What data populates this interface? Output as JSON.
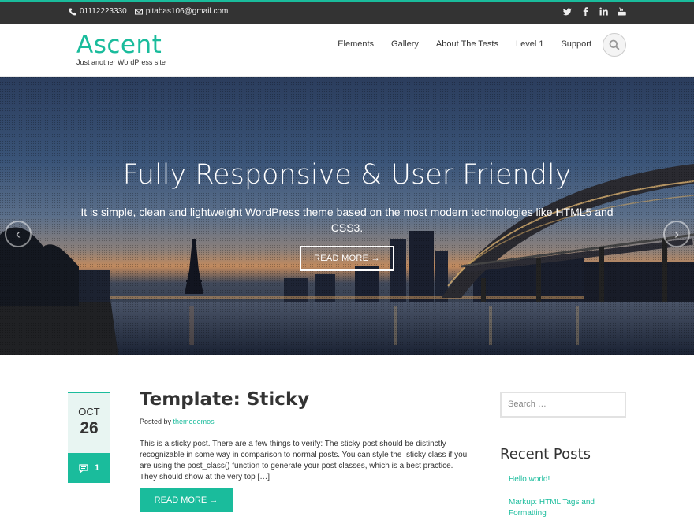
{
  "topbar": {
    "phone": "01112223330",
    "email": "pitabas106@gmail.com",
    "social": [
      "twitter-icon",
      "facebook-icon",
      "linkedin-icon",
      "youtube-icon"
    ]
  },
  "header": {
    "logo": "Ascent",
    "tagline": "Just another WordPress site",
    "nav": [
      "Elements",
      "Gallery",
      "About The Tests",
      "Level 1",
      "Support"
    ]
  },
  "hero": {
    "title": "Fully Responsive & User Friendly",
    "subtitle": "It is simple, clean and lightweight WordPress theme based on the most modern technologies like HTML5 and CSS3.",
    "button": "READ MORE →",
    "prev_arrow": "‹",
    "next_arrow": "›"
  },
  "post": {
    "month": "OCT",
    "day": "26",
    "comments": "1",
    "title": "Template: Sticky",
    "posted_by": "Posted by",
    "author": "themedemos",
    "excerpt": "This is a sticky post. There are a few things to verify: The sticky post should be distinctly recognizable in some way in comparison to normal posts. You can style the .sticky class if you are using the post_class() function to generate your post classes, which is a best practice. They should show at the very top […]",
    "read_more": "READ MORE →"
  },
  "sidebar": {
    "search_placeholder": "Search …",
    "recent_title": "Recent Posts",
    "recent_posts": [
      "Hello world!",
      "Markup: HTML Tags and Formatting"
    ]
  },
  "colors": {
    "accent": "#1abc9c",
    "topbar": "#333333"
  }
}
